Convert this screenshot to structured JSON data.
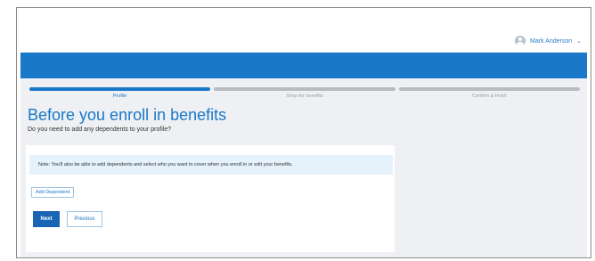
{
  "header": {
    "user_name": "Mark Anderson"
  },
  "progress": {
    "steps": [
      {
        "label": "Profile",
        "active": true
      },
      {
        "label": "Shop for benefits",
        "active": false
      },
      {
        "label": "Confirm & finish",
        "active": false
      }
    ]
  },
  "main": {
    "title": "Before you enroll in benefits",
    "subtitle": "Do you need to add any dependents to your profile?",
    "note": "Note: You'll also be able to add dependents and select who you want to cover when you enroll in or edit your benefits.",
    "add_dependent_label": "Add Dependent",
    "next_label": "Next",
    "previous_label": "Previous"
  },
  "colors": {
    "accent": "#1a78c8",
    "progress_active": "#1a78c8",
    "progress_inactive": "#b8bcc1"
  }
}
